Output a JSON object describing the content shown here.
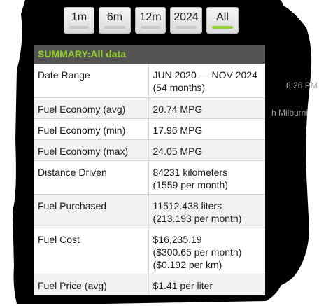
{
  "range_buttons": [
    {
      "label": "1m",
      "active": false
    },
    {
      "label": "6m",
      "active": false
    },
    {
      "label": "12m",
      "active": false
    },
    {
      "label": "2024",
      "active": false
    },
    {
      "label": "All",
      "active": true
    }
  ],
  "background_text": {
    "time": "8:26 PM",
    "name": "h Milburni"
  },
  "summary": {
    "title": "SUMMARY:All data",
    "rows": [
      {
        "key": "Date Range",
        "lines": [
          "JUN 2020 — NOV 2024",
          "(54 months)"
        ]
      },
      {
        "key": "Fuel Economy (avg)",
        "lines": [
          "20.74 MPG"
        ]
      },
      {
        "key": "Fuel Economy (min)",
        "lines": [
          "17.96 MPG"
        ]
      },
      {
        "key": "Fuel Economy (max)",
        "lines": [
          "24.05 MPG"
        ]
      },
      {
        "key": "Distance Driven",
        "lines": [
          "84231 kilometers",
          "(1559 per month)"
        ]
      },
      {
        "key": "Fuel Purchased",
        "lines": [
          "11512.438 liters",
          "(213.193 per month)"
        ]
      },
      {
        "key": "Fuel Cost",
        "lines": [
          "$16,235.19",
          "($300.65 per month)",
          "($0.192 per km)"
        ]
      },
      {
        "key": "Fuel Price (avg)",
        "lines": [
          "$1.41 per liter"
        ]
      }
    ]
  },
  "colors": {
    "accent": "#8ed12a",
    "header_bg": "#545454",
    "backdrop": "#000000"
  }
}
